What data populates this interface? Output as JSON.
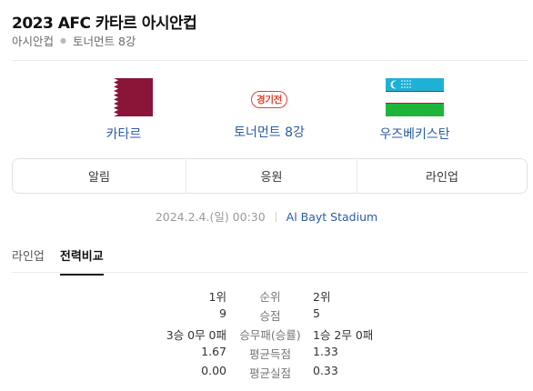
{
  "header": {
    "title": "2023 AFC 카타르 아시안컵",
    "breadcrumb": [
      "아시안컵",
      "토너먼트 8강"
    ]
  },
  "match": {
    "home_team": "카타르",
    "away_team": "우즈베키스탄",
    "status_badge": "경기전",
    "round": "토너먼트 8강",
    "datetime": "2024.2.4.(일) 00:30",
    "stadium": "Al Bayt Stadium"
  },
  "tabs": [
    "알림",
    "응원",
    "라인업"
  ],
  "subtabs": [
    "라인업",
    "전력비교"
  ],
  "comparison": [
    {
      "home": "1위",
      "label": "순위",
      "away": "2위"
    },
    {
      "home": "9",
      "label": "승점",
      "away": "5"
    },
    {
      "home": "3승 0무 0패",
      "label": "승무패(승률)",
      "away": "1승 2무 0패"
    },
    {
      "home": "1.67",
      "label": "평균득점",
      "away": "1.33"
    },
    {
      "home": "0.00",
      "label": "평균실점",
      "away": "0.33"
    }
  ],
  "colors": {
    "link": "#2a5ca8",
    "badge": "#e5402f",
    "qatar_maroon": "#8a1538",
    "uzbek_blue": "#1eb1d6",
    "uzbek_green": "#1eb53a",
    "uzbek_red": "#ce1126"
  }
}
